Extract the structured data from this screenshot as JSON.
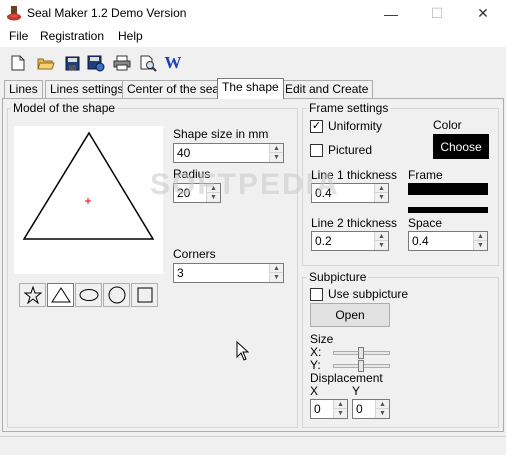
{
  "window": {
    "title": "Seal Maker 1.2 Demo Version",
    "minimize": "—",
    "maximize": "☐",
    "close": "✕"
  },
  "menu": [
    "File",
    "Registration",
    "Help"
  ],
  "toolbar": {
    "icons": [
      "new-file-icon",
      "open-folder-icon",
      "save-icon",
      "save-as-icon",
      "print-icon",
      "print-preview-icon",
      "word-export-icon"
    ],
    "word_letter": "W"
  },
  "tabs": [
    {
      "label": "Lines",
      "active": false
    },
    {
      "label": "Lines settings",
      "active": false
    },
    {
      "label": "Center of the seal",
      "active": false
    },
    {
      "label": "The shape",
      "active": true
    },
    {
      "label": "Edit and Create",
      "active": false
    }
  ],
  "model": {
    "group_label": "Model of the shape",
    "shape_size_label": "Shape size in mm",
    "shape_size_value": "40",
    "radius_label": "Radius",
    "radius_value": "20",
    "corners_label": "Corners",
    "corners_value": "3",
    "shape_buttons": [
      "star",
      "triangle",
      "ellipse",
      "circle",
      "square"
    ],
    "selected_shape": "triangle"
  },
  "frame": {
    "group_label": "Frame settings",
    "uniformity_label": "Uniformity",
    "uniformity_checked": true,
    "pictured_label": "Pictured",
    "pictured_checked": false,
    "color_label": "Color",
    "choose_label": "Choose",
    "color_value": "#000000",
    "line1_label": "Line 1 thickness",
    "line1_value": "0.4",
    "frame_label": "Frame",
    "line2_label": "Line 2 thickness",
    "line2_value": "0.2",
    "space_label": "Space",
    "space_value": "0.4"
  },
  "subpicture": {
    "group_label": "Subpicture",
    "use_label": "Use subpicture",
    "use_checked": false,
    "open_label": "Open",
    "size_label": "Size",
    "x_label": "X:",
    "y_label": "Y:",
    "displacement_label": "Displacement",
    "disp_x_label": "X",
    "disp_y_label": "Y",
    "disp_x_value": "0",
    "disp_y_value": "0"
  },
  "watermark": "SOFTPEDIA"
}
